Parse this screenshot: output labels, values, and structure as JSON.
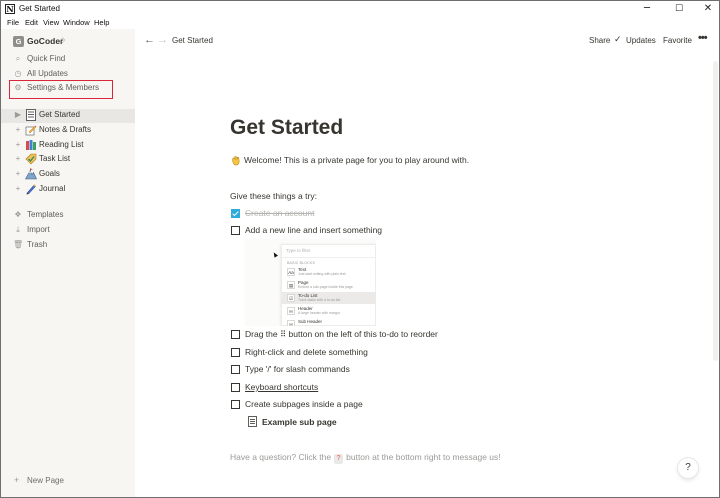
{
  "window": {
    "title": "Get Started"
  },
  "menu": [
    "File",
    "Edit",
    "View",
    "Window",
    "Help"
  ],
  "sidebar": {
    "workspace_badge": "G",
    "workspace_name": "GoCoder",
    "nav": [
      {
        "label": "Quick Find",
        "icon": "search-icon"
      },
      {
        "label": "All Updates",
        "icon": "clock-icon"
      },
      {
        "label": "Settings & Members",
        "icon": "gear-icon"
      }
    ],
    "pages": [
      {
        "label": "Get Started",
        "icon": "page-icon",
        "active": true
      },
      {
        "label": "Notes & Drafts",
        "icon": "pencil-note-emoji"
      },
      {
        "label": "Reading List",
        "icon": "books-emoji"
      },
      {
        "label": "Task List",
        "icon": "check-tag-emoji"
      },
      {
        "label": "Goals",
        "icon": "mountain-emoji"
      },
      {
        "label": "Journal",
        "icon": "journal-emoji"
      }
    ],
    "tools": [
      {
        "label": "Templates",
        "icon": "templates-icon"
      },
      {
        "label": "Import",
        "icon": "import-icon"
      },
      {
        "label": "Trash",
        "icon": "trash-icon"
      }
    ],
    "new_page": "New Page"
  },
  "topbar": {
    "breadcrumb": "Get Started",
    "share": "Share",
    "updates": "Updates",
    "favorite": "Favorite"
  },
  "page": {
    "title": "Get Started",
    "welcome": "Welcome! This is a private page for you to play around with.",
    "try_heading": "Give these things a try:",
    "todos": [
      {
        "text": "Create an account",
        "checked": true
      },
      {
        "text": "Add a new line and insert something",
        "checked": false
      },
      {
        "text": "Drag the ⠿ button on the left of this to-do to reorder",
        "checked": false
      },
      {
        "text": "Right-click and delete something",
        "checked": false
      },
      {
        "text": "Type '/' for slash commands",
        "checked": false
      },
      {
        "text": "Keyboard shortcuts",
        "checked": false,
        "underlined": true
      },
      {
        "text": "Create subpages inside a page",
        "checked": false
      }
    ],
    "preview_menu": {
      "filter": "Type to filter",
      "section": "BASIC BLOCKS",
      "items": [
        {
          "glyph": "Aa",
          "title": "Text",
          "desc": "Just start writing with plain text."
        },
        {
          "glyph": "▤",
          "title": "Page",
          "desc": "Embed a sub-page inside this page."
        },
        {
          "glyph": "☑",
          "title": "To-do List",
          "desc": "Track tasks with a to-do list.",
          "selected": true
        },
        {
          "glyph": "H",
          "title": "Header",
          "desc": "A large header with margin."
        },
        {
          "glyph": "H",
          "title": "Sub Header",
          "desc": ""
        }
      ]
    },
    "subpage": "Example sub page",
    "question_prefix": "Have a question? Click the",
    "question_chip": "?",
    "question_suffix": "button at the bottom right to message us!",
    "help_button": "?"
  }
}
